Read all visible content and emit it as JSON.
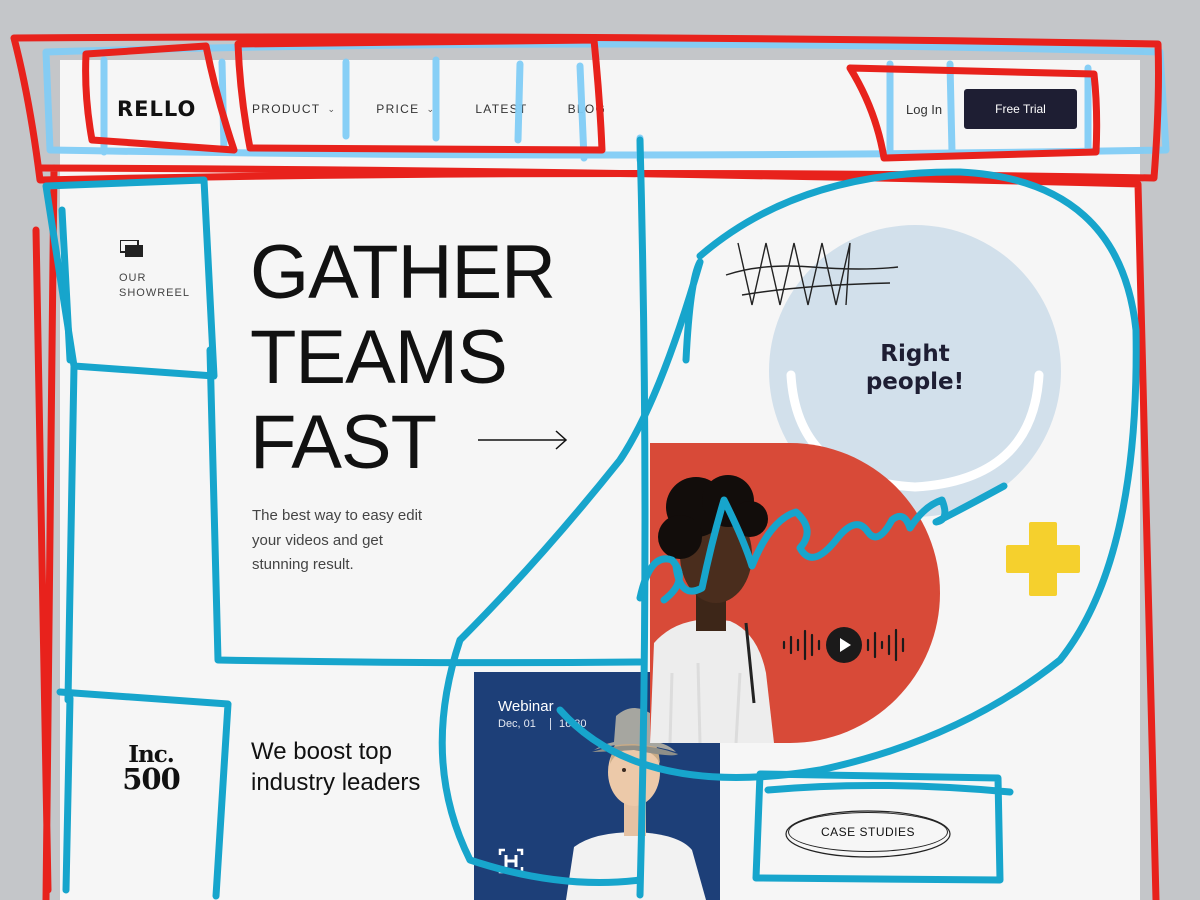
{
  "header": {
    "logo": "RELLO",
    "nav": [
      {
        "label": "PRODUCT",
        "has_dropdown": true
      },
      {
        "label": "PRICE",
        "has_dropdown": true
      },
      {
        "label": "LATEST",
        "has_dropdown": false
      },
      {
        "label": "BLOG",
        "has_dropdown": false
      }
    ],
    "login_label": "Log In",
    "trial_label": "Free Trial"
  },
  "sidebar": {
    "showreel_label": "OUR SHOWREEL",
    "inc_line1": "Inc.",
    "inc_line2": "500"
  },
  "hero": {
    "headline": [
      "GATHER",
      "TEAMS",
      "FAST"
    ],
    "subtext": "The best way to easy edit  your videos and get stunning result.",
    "boost_text": "We boost top industry leaders"
  },
  "webinar": {
    "title": "Webinar",
    "date": "Dec, 01",
    "time": "16:30"
  },
  "right": {
    "circle_text": "Right people!",
    "case_studies_label": "CASE STUDIES"
  },
  "annotation": {
    "handwriting": "awesome"
  },
  "colors": {
    "page_bg": "#f6f6f6",
    "backdrop": "#c4c6c9",
    "button_dark": "#1e1e33",
    "webinar_blue": "#1d3f78",
    "circle_blue": "#d2e0eb",
    "accent_red": "#d84a38",
    "accent_yellow": "#f5d02d",
    "annotation_red": "#e8221c",
    "annotation_cyan": "#17a5cc",
    "annotation_light_blue": "#82cdf6"
  }
}
